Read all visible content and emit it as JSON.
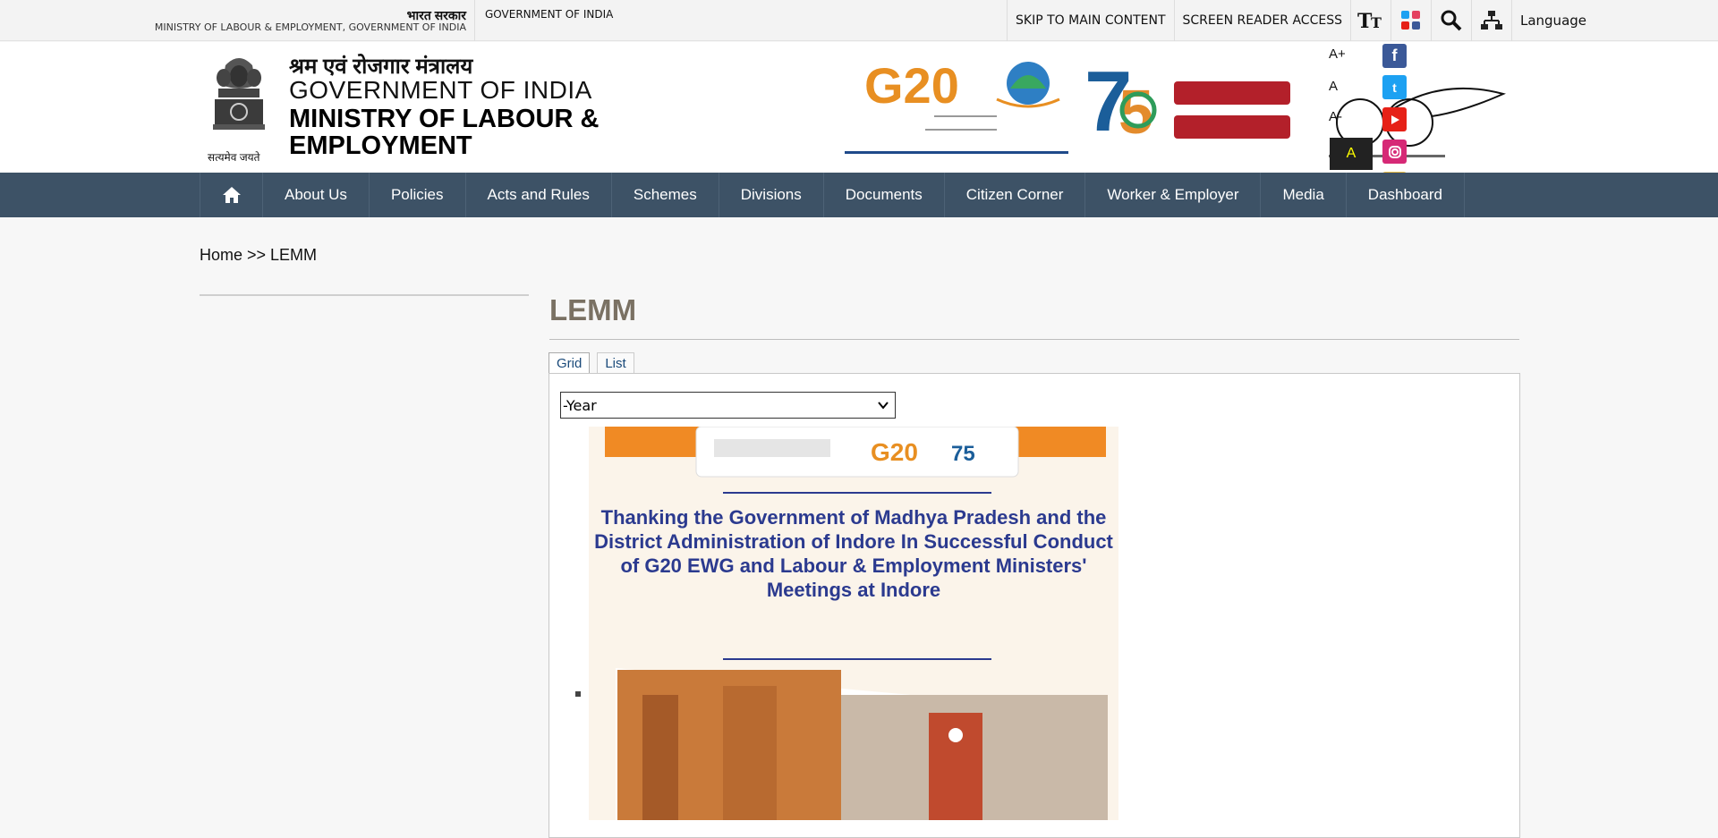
{
  "topbar": {
    "bharat_sarkar": "भारत सरकार",
    "ministry_line": "MINISTRY OF LABOUR & EMPLOYMENT, GOVERNMENT OF INDIA",
    "goi": "GOVERNMENT OF INDIA",
    "skip": "SKIP TO MAIN CONTENT",
    "screen_reader": "SCREEN READER ACCESS",
    "language": "Language"
  },
  "header": {
    "hindi_ministry": "श्रम एवं रोजगार मंत्रालय",
    "goi": "GOVERNMENT OF INDIA",
    "ministry_line1": "MINISTRY OF LABOUR &",
    "ministry_line2": "EMPLOYMENT",
    "emblem_caption": "सत्यमेव जयते"
  },
  "font_controls": {
    "increase": "A+",
    "normal": "A",
    "decrease": "A-",
    "contrast": "A"
  },
  "nav": {
    "items": [
      "About Us",
      "Policies",
      "Acts and Rules",
      "Schemes",
      "Divisions",
      "Documents",
      "Citizen Corner",
      "Worker & Employer",
      "Media",
      "Dashboard"
    ]
  },
  "breadcrumb": "Home >> LEMM",
  "page": {
    "title": "LEMM",
    "tabs": [
      "Grid",
      "List"
    ],
    "year_select": "-Year"
  },
  "poster": {
    "title": "Thanking the Government of Madhya Pradesh and the District Administration of Indore In Successful Conduct of G20 EWG and Labour & Employment Ministers' Meetings at Indore"
  },
  "colors": {
    "nav_bg": "#3d5266",
    "title": "#7a7163",
    "poster_title": "#2b3a8f"
  }
}
